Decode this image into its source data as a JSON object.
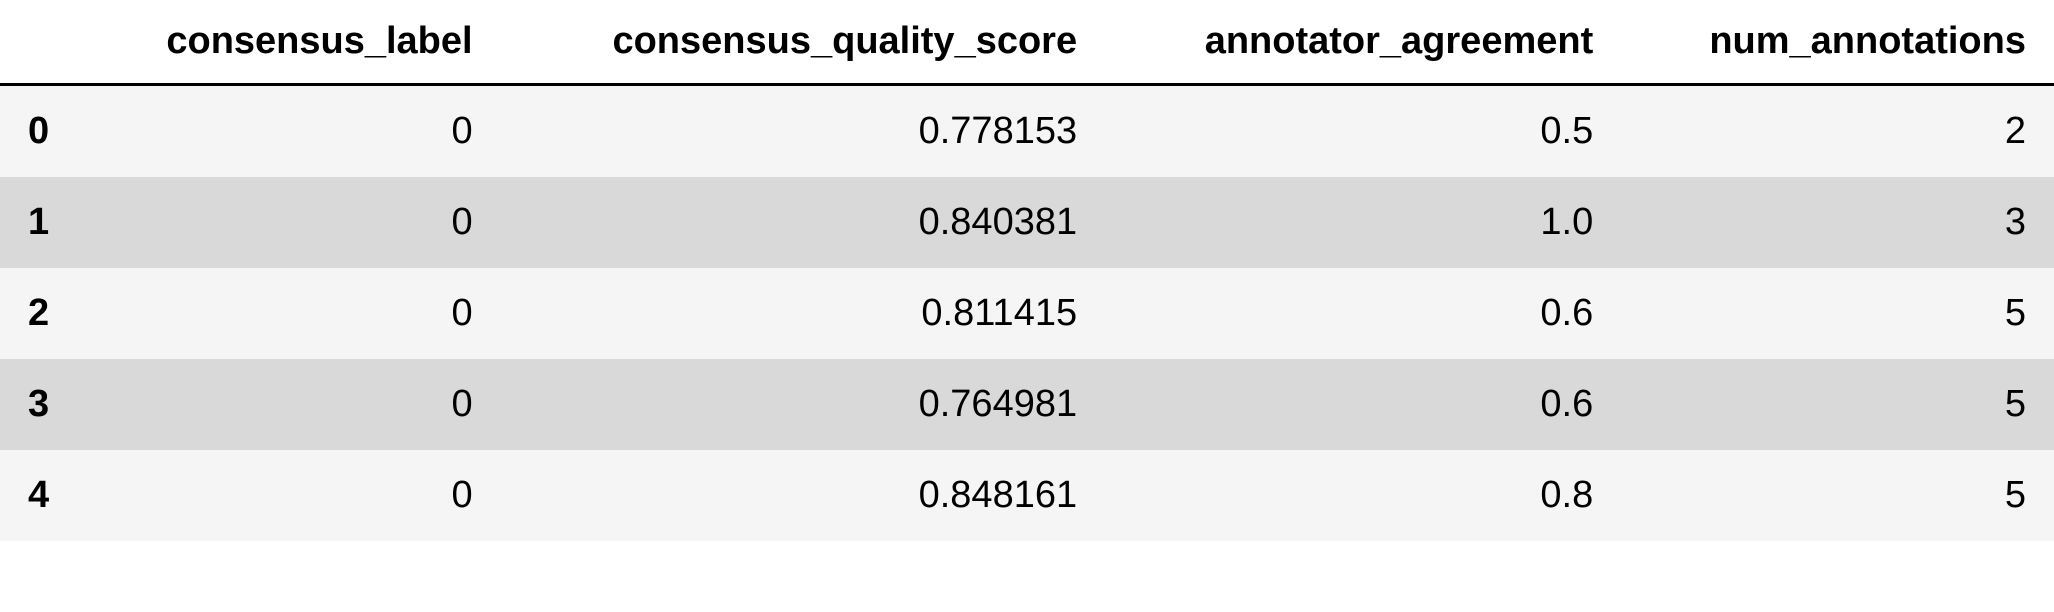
{
  "table": {
    "columns": [
      "",
      "consensus_label",
      "consensus_quality_score",
      "annotator_agreement",
      "num_annotations"
    ],
    "rows": [
      {
        "index": "0",
        "consensus_label": "0",
        "consensus_quality_score": "0.778153",
        "annotator_agreement": "0.5",
        "num_annotations": "2"
      },
      {
        "index": "1",
        "consensus_label": "0",
        "consensus_quality_score": "0.840381",
        "annotator_agreement": "1.0",
        "num_annotations": "3"
      },
      {
        "index": "2",
        "consensus_label": "0",
        "consensus_quality_score": "0.811415",
        "annotator_agreement": "0.6",
        "num_annotations": "5"
      },
      {
        "index": "3",
        "consensus_label": "0",
        "consensus_quality_score": "0.764981",
        "annotator_agreement": "0.6",
        "num_annotations": "5"
      },
      {
        "index": "4",
        "consensus_label": "0",
        "consensus_quality_score": "0.848161",
        "annotator_agreement": "0.8",
        "num_annotations": "5"
      }
    ]
  }
}
